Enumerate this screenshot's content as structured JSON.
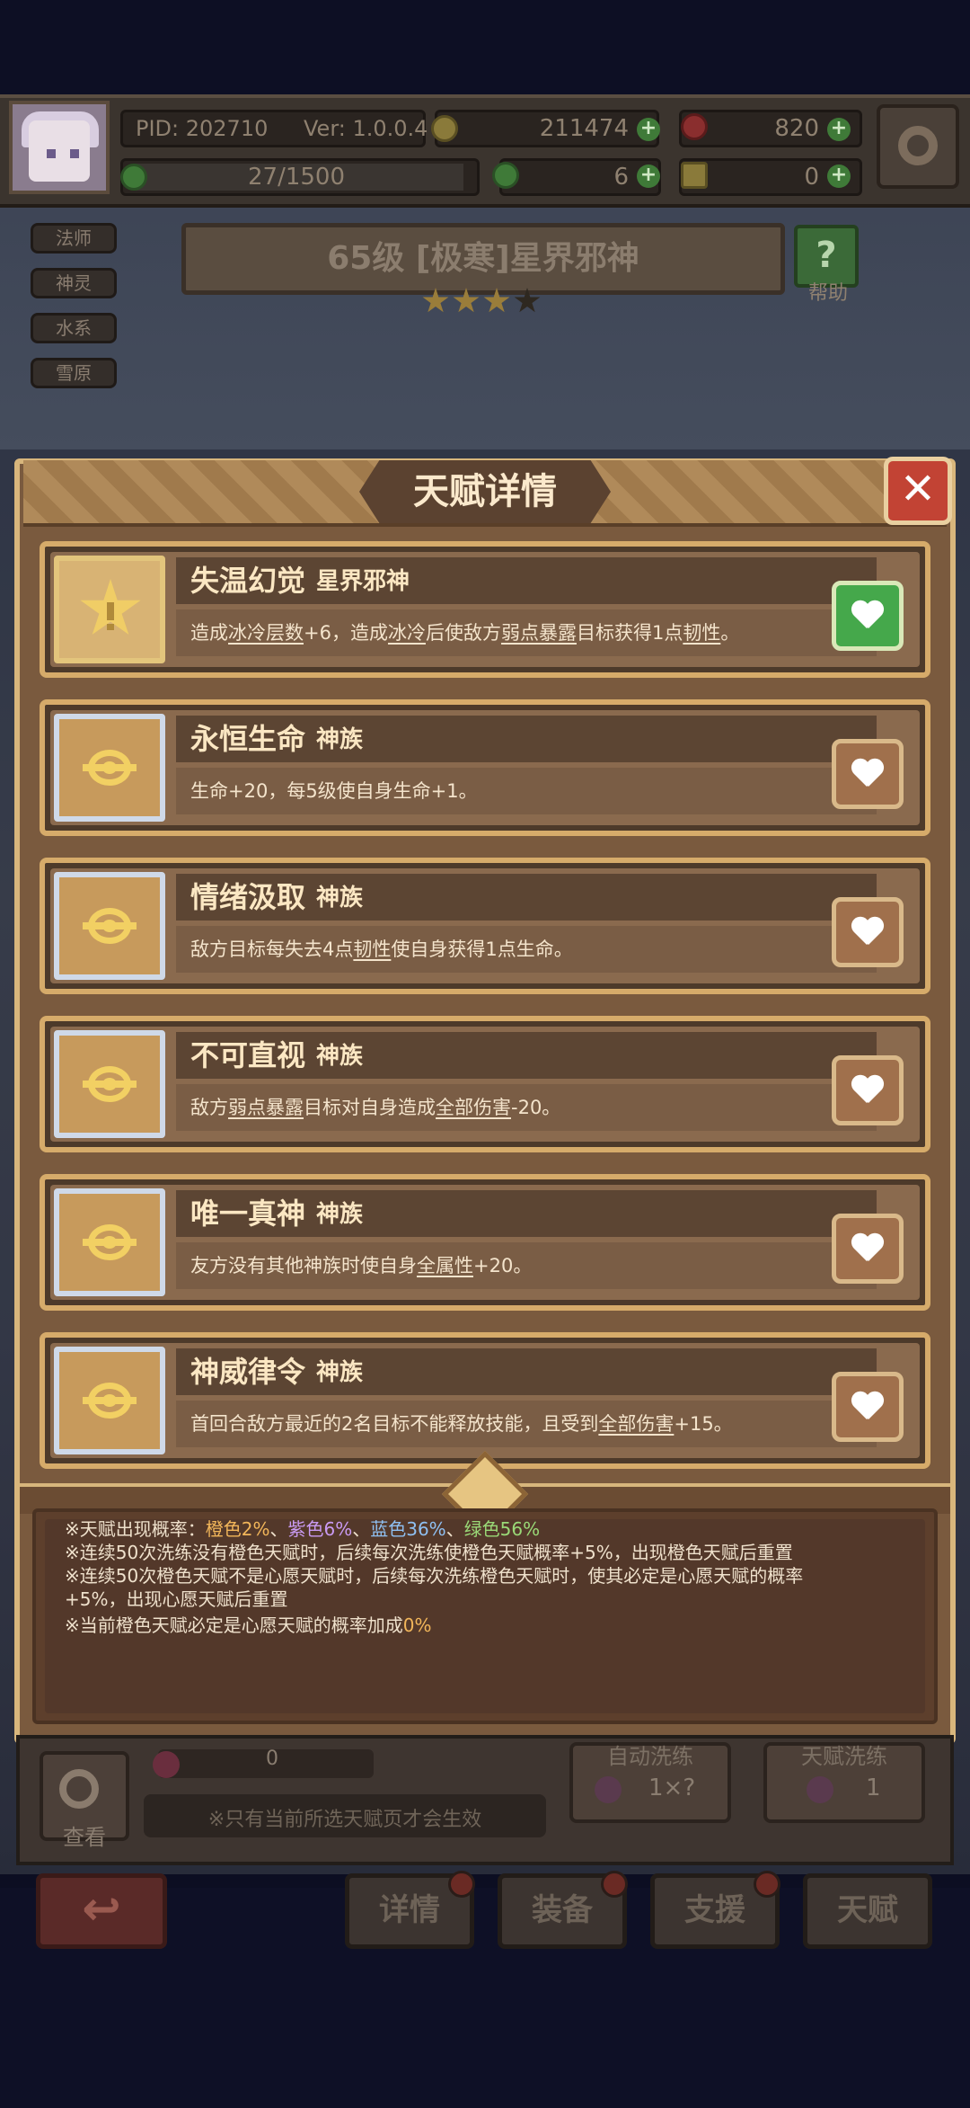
{
  "topbar": {
    "pid": "PID: 202710",
    "version": "Ver: 1.0.0.4",
    "gold": "211474",
    "gems": "820",
    "exp": "27/1500",
    "clover": "6",
    "keys": "0",
    "plus": "+"
  },
  "tags": [
    "法师",
    "神灵",
    "水系",
    "雪原"
  ],
  "boss": {
    "title": "65级 [极寒]星界邪神",
    "help_label": "帮助",
    "help_icon": "?"
  },
  "modal": {
    "title": "天赋详情",
    "close": "✕"
  },
  "talents": [
    {
      "name": "失温幻觉",
      "type": "星界邪神",
      "selected": true,
      "desc": [
        "造成",
        {
          "u": "冰冷层数"
        },
        "+6，造成",
        {
          "u": "冰冷"
        },
        "后使敌方",
        {
          "u": "弱点暴露"
        },
        "目标获得1点",
        {
          "u": "韧性"
        },
        "。"
      ]
    },
    {
      "name": "永恒生命",
      "type": "神族",
      "selected": false,
      "desc": [
        "生命+20，每5级使自身生命+1。"
      ]
    },
    {
      "name": "情绪汲取",
      "type": "神族",
      "selected": false,
      "desc": [
        "敌方目标每失去4点",
        {
          "u": "韧性"
        },
        "使自身获得1点生命。"
      ]
    },
    {
      "name": "不可直视",
      "type": "神族",
      "selected": false,
      "desc": [
        "敌方",
        {
          "u": "弱点暴露"
        },
        "目标对自身造成",
        {
          "u": "全部伤害"
        },
        "-20。"
      ]
    },
    {
      "name": "唯一真神",
      "type": "神族",
      "selected": false,
      "desc": [
        "友方没有其他神族时使自身",
        {
          "u": "全属性"
        },
        "+20。"
      ]
    },
    {
      "name": "神威律令",
      "type": "神族",
      "selected": false,
      "desc": [
        "首回合敌方最近的2名目标不能释放技能，且受到",
        {
          "u": "全部伤害"
        },
        "+15。"
      ]
    }
  ],
  "info": {
    "line1_prefix": "※天赋出现概率：",
    "rates": [
      {
        "text": "橙色2%",
        "color": "#f2b65a"
      },
      {
        "text": "紫色6%",
        "color": "#c99af2"
      },
      {
        "text": "蓝色36%",
        "color": "#8fc0f2"
      },
      {
        "text": "绿色56%",
        "color": "#9ad977"
      }
    ],
    "sep": "、",
    "line2": "※连续50次洗练没有橙色天赋时，后续每次洗练使橙色天赋概率+5%，出现橙色天赋后重置",
    "line3": "※连续50次橙色天赋不是心愿天赋时，后续每次洗练橙色天赋时，使其必定是心愿天赋的概率",
    "line4": "+5%，出现心愿天赋后重置",
    "line5_prefix": "※当前橙色天赋必定是心愿天赋的概率加成",
    "line5_value": "0%",
    "accent": "#f2b65a"
  },
  "bottom": {
    "view_label": "查看",
    "count": "0",
    "hint": "※只有当前所选天赋页才会生效",
    "auto_wash_title": "自动洗练",
    "auto_wash_value": "1×?",
    "wash_title": "天赋洗练",
    "wash_value": "1"
  },
  "nav": {
    "back_icon": "↩",
    "tabs": [
      "详情",
      "装备",
      "支援",
      "天赋"
    ]
  },
  "colors": {
    "card_border": "#d6ab6a",
    "selected_heart": "#45a84b",
    "modal_border": "#d8b67c"
  }
}
